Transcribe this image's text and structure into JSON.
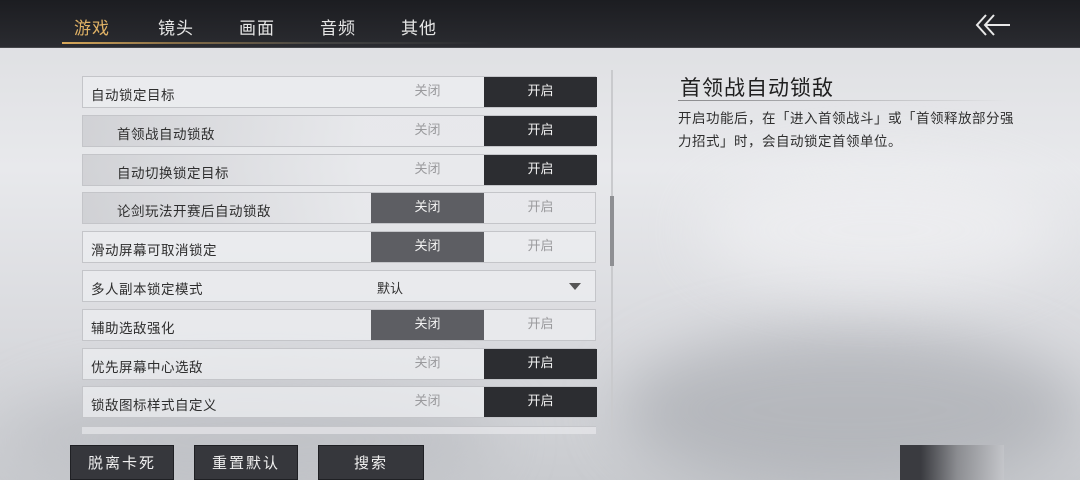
{
  "tabs": [
    {
      "label": "游戏",
      "active": true
    },
    {
      "label": "镜头",
      "active": false
    },
    {
      "label": "画面",
      "active": false
    },
    {
      "label": "音频",
      "active": false
    },
    {
      "label": "其他",
      "active": false
    }
  ],
  "toggle_labels": {
    "off": "关闭",
    "on": "开启"
  },
  "settings": [
    {
      "label": "自动锁定目标",
      "sub": false,
      "type": "toggle",
      "value": "on"
    },
    {
      "label": "首领战自动锁敌",
      "sub": true,
      "type": "toggle",
      "value": "on"
    },
    {
      "label": "自动切换锁定目标",
      "sub": true,
      "type": "toggle",
      "value": "on"
    },
    {
      "label": "论剑玩法开赛后自动锁敌",
      "sub": true,
      "type": "toggle",
      "value": "off"
    },
    {
      "label": "滑动屏幕可取消锁定",
      "sub": false,
      "type": "toggle",
      "value": "off"
    },
    {
      "label": "多人副本锁定模式",
      "sub": false,
      "type": "dropdown",
      "value": "默认"
    },
    {
      "label": "辅助选敌强化",
      "sub": false,
      "type": "toggle",
      "value": "off"
    },
    {
      "label": "优先屏幕中心选敌",
      "sub": false,
      "type": "toggle",
      "value": "on"
    },
    {
      "label": "锁敌图标样式自定义",
      "sub": false,
      "type": "toggle",
      "value": "on"
    }
  ],
  "description": {
    "title": "首领战自动锁敌",
    "body": "开启功能后，在「进入首领战斗」或「首领释放部分强力招式」时，会自动锁定首领单位。"
  },
  "buttons": {
    "unstuck": "脱离卡死",
    "reset_default": "重置默认",
    "search": "搜索"
  },
  "icons": {
    "back": "double-chevron-left-icon",
    "dropdown": "chevron-down-icon"
  },
  "colors": {
    "active_tab": "#e0b266",
    "topbar": "#1c1d21",
    "toggle_on": "#2c2d31",
    "toggle_off": "#5d5e63"
  }
}
